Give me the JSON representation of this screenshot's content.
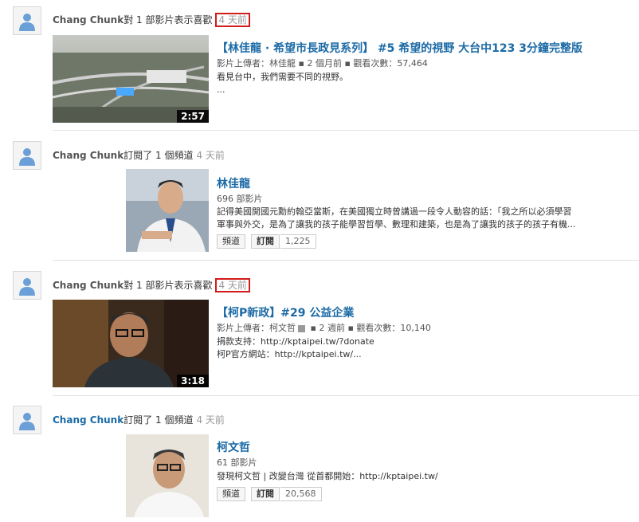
{
  "items": [
    {
      "user": "Chang Chunk",
      "action": "對 1 部影片表示喜歡",
      "time": "4 天前",
      "video": {
        "title": "【林佳龍 · 希望市長政見系列】 #5 希望的視野 大台中123 3分鐘完整版",
        "uploader_label": "影片上傳者：林佳龍",
        "age": "2 個月前",
        "views": "觀看次數：57,464",
        "desc_line1": "看見台中，我們需要不同的視野。",
        "desc_line2": "...",
        "duration": "2:57"
      }
    },
    {
      "user": "Chang Chunk",
      "action": "訂閱了 1 個頻道",
      "time": "4 天前",
      "channel": {
        "name": "林佳龍",
        "videos": "696 部影片",
        "desc_line1": "記得美國開國元勳約翰亞當斯，在美國獨立時曾講過一段令人動容的話：「我之所以必須學習",
        "desc_line2": "軍事與外交，是為了讓我的孩子能學習哲學、數理和建築，也是為了讓我的孩子的孩子有機...",
        "channel_btn": "頻道",
        "subscribe_btn": "訂閱",
        "sub_count": "1,225"
      }
    },
    {
      "user": "Chang Chunk",
      "action": "對 1 部影片表示喜歡",
      "time": "4 天前",
      "video": {
        "title": "【柯P新政】#29 公益企業",
        "uploader_label": "影片上傳者：柯文哲",
        "age": "2 週前",
        "views": "觀看次數：10,140",
        "desc_line1": "捐款支持：http://kptaipei.tw/?donate",
        "desc_line2": "柯P官方網站：http://kptaipei.tw/...",
        "duration": "3:18"
      }
    },
    {
      "user": "Chang Chunk",
      "action": "訂閱了 1 個頻道",
      "time": "4 天前",
      "channel": {
        "name": "柯文哲",
        "videos": "61 部影片",
        "desc_line1": "發現柯文哲 | 改變台灣 從首都開始：http://kptaipei.tw/",
        "channel_btn": "頻道",
        "subscribe_btn": "訂閱",
        "sub_count": "20,568"
      }
    }
  ]
}
